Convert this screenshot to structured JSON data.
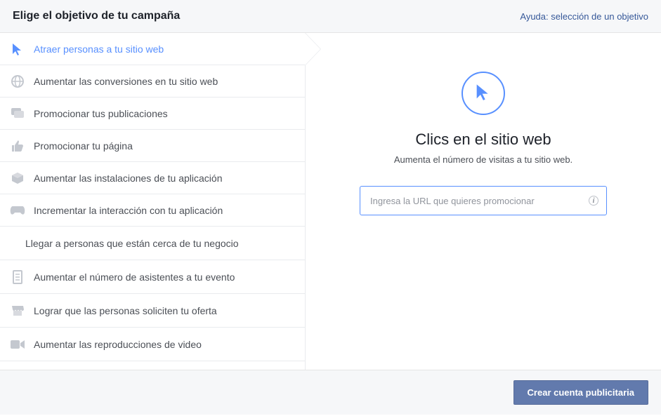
{
  "header": {
    "title": "Elige el objetivo de tu campaña",
    "help_link": "Ayuda: selección de un objetivo"
  },
  "sidebar": {
    "items": [
      {
        "icon": "cursor-icon",
        "label": "Atraer personas a tu sitio web",
        "selected": true
      },
      {
        "icon": "globe-icon",
        "label": "Aumentar las conversiones en tu sitio web",
        "selected": false
      },
      {
        "icon": "chat-icon",
        "label": "Promocionar tus publicaciones",
        "selected": false
      },
      {
        "icon": "like-icon",
        "label": "Promocionar tu página",
        "selected": false
      },
      {
        "icon": "package-icon",
        "label": "Aumentar las instalaciones de tu aplicación",
        "selected": false
      },
      {
        "icon": "gamepad-icon",
        "label": "Incrementar la interacción con tu aplicación",
        "selected": false
      },
      {
        "icon": "",
        "label": "Llegar a personas que están cerca de tu negocio",
        "selected": false
      },
      {
        "icon": "document-icon",
        "label": "Aumentar el número de asistentes a tu evento",
        "selected": false
      },
      {
        "icon": "store-icon",
        "label": "Lograr que las personas soliciten tu oferta",
        "selected": false
      },
      {
        "icon": "video-icon",
        "label": "Aumentar las reproducciones de video",
        "selected": false
      }
    ]
  },
  "main": {
    "title": "Clics en el sitio web",
    "subtitle": "Aumenta el número de visitas a tu sitio web.",
    "url_placeholder": "Ingresa la URL que quieres promocionar",
    "hero_icon": "cursor-icon"
  },
  "footer": {
    "cta_label": "Crear cuenta publicitaria"
  },
  "colors": {
    "accent": "#5890ff",
    "link": "#365899",
    "button": "#627aad"
  }
}
